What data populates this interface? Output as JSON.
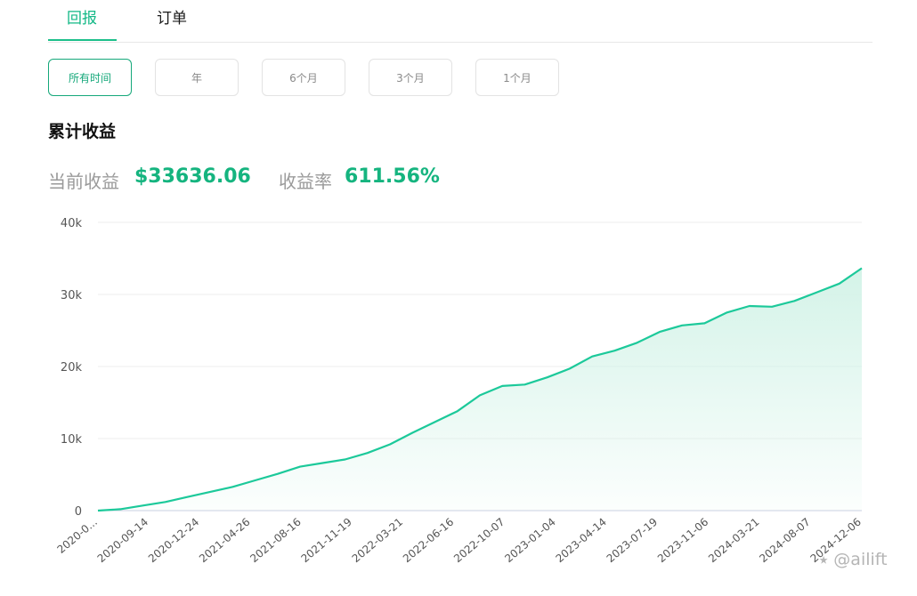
{
  "tabs": {
    "returns": "回报",
    "orders": "订单"
  },
  "ranges": [
    "所有时间",
    "年",
    "6个月",
    "3个月",
    "1个月"
  ],
  "section_title": "累计收益",
  "stats": {
    "current_label": "当前收益",
    "current_value": "$33636.06",
    "rate_label": "收益率",
    "rate_value": "611.56%"
  },
  "watermark": "⭑ @ailift",
  "colors": {
    "accent": "#15b47f",
    "line": "#1cc99a",
    "fill": "#d4f3e8"
  },
  "chart_data": {
    "type": "area",
    "title": "累计收益",
    "xlabel": "",
    "ylabel": "",
    "ylim": [
      0,
      40000
    ],
    "yticks": [
      0,
      10000,
      20000,
      30000,
      40000
    ],
    "ytick_labels": [
      "0",
      "10k",
      "20k",
      "30k",
      "40k"
    ],
    "xtick_labels": [
      "2020-0...",
      "2020-09-14",
      "2020-12-24",
      "2021-04-26",
      "2021-08-16",
      "2021-11-19",
      "2022-03-21",
      "2022-06-16",
      "2022-10-07",
      "2023-01-04",
      "2023-04-14",
      "2023-07-19",
      "2023-11-06",
      "2024-03-21",
      "2024-08-07",
      "2024-12-06"
    ],
    "grid": true,
    "series": [
      {
        "values": [
          0,
          200,
          700,
          1200,
          1900,
          2600,
          3300,
          4200,
          5100,
          6100,
          6600,
          7100,
          8000,
          9200,
          10800,
          12300,
          13800,
          16000,
          17300,
          17500,
          18500,
          19700,
          21400,
          22200,
          23300,
          24800,
          25700,
          26000,
          27500,
          28400,
          28300,
          29100,
          30300,
          31500,
          33636.06
        ]
      }
    ]
  }
}
